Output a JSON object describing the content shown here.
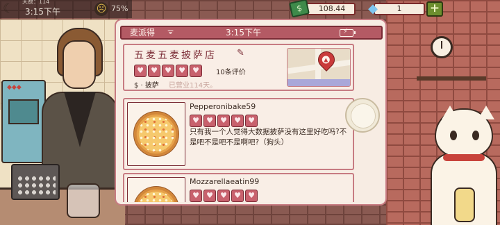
{
  "hud": {
    "day": "天数：114",
    "time": "3:15下午",
    "mood_percent": "75%",
    "money": "108.44",
    "gems": "1",
    "plus_label": "+"
  },
  "phone": {
    "app_name": "麦派得",
    "signal": "ᯤ",
    "time": "3:15下午"
  },
  "shop": {
    "name": "五麦五麦披萨店",
    "review_count": "10条评价",
    "price_type": "$ · 披萨",
    "open_days": "已营业114天。"
  },
  "reviews": [
    {
      "name": "Pepperonibake59",
      "text": "只有我一个人觉得大数据披萨没有这里好吃吗?不是吧不是吧不是啊吧?（狗头）"
    },
    {
      "name": "Mozzarellaeatin99",
      "text": ""
    }
  ],
  "icons": {
    "moon": "moon-icon",
    "mood": "mood-face-icon",
    "money": "cash-icon",
    "gem": "diamond-icon",
    "edit": "pencil-icon",
    "map_pin": "pizza-map-pin-icon",
    "battery": "battery-charging-icon"
  },
  "colors": {
    "accent": "#b45a64",
    "accent_dark": "#7a2b35",
    "panel": "#f7ece3",
    "plus_green": "#6c8e2e"
  }
}
